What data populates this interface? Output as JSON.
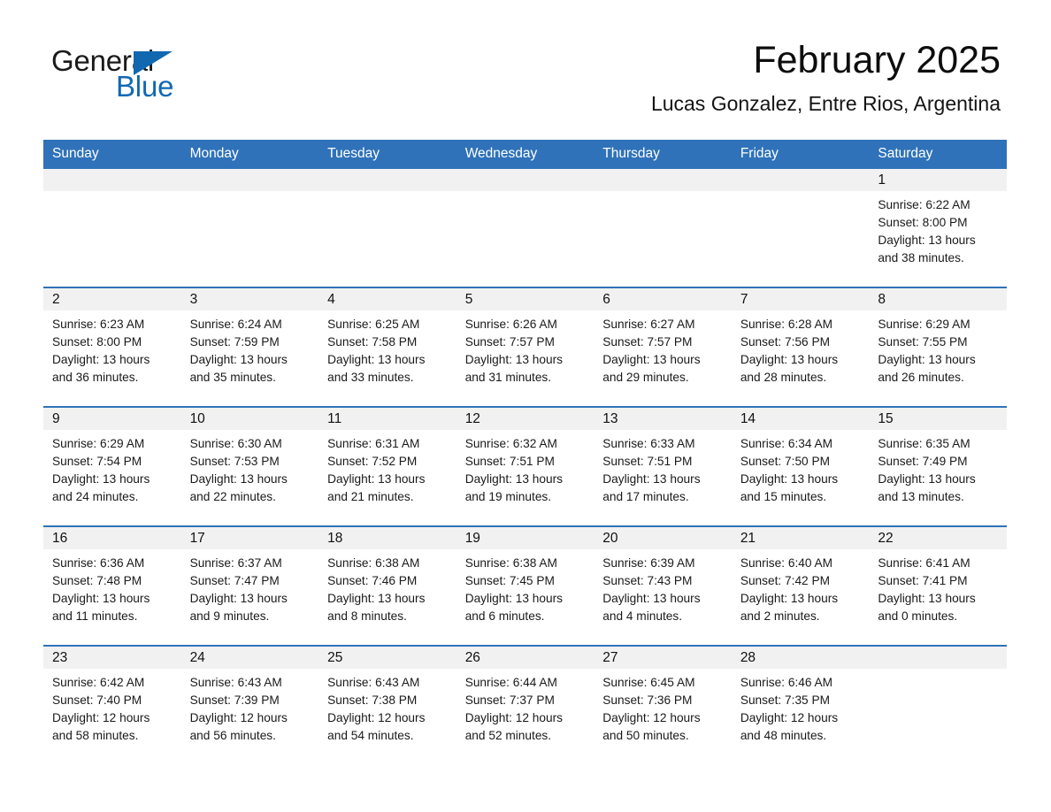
{
  "brand": {
    "name_part1": "General",
    "name_part2": "Blue",
    "logo_icon": "triangle-flag-icon",
    "accent_color": "#1268b3"
  },
  "header": {
    "month_title": "February 2025",
    "location": "Lucas Gonzalez, Entre Rios, Argentina"
  },
  "theme": {
    "header_blue": "#2f72b9",
    "row_divider_blue": "#2f72b9",
    "daynum_band": "#f1f1f1"
  },
  "calendar": {
    "weekday_headers": [
      "Sunday",
      "Monday",
      "Tuesday",
      "Wednesday",
      "Thursday",
      "Friday",
      "Saturday"
    ],
    "weeks": [
      [
        {
          "day": "",
          "sunrise": "",
          "sunset": "",
          "daylight": "",
          "empty": true
        },
        {
          "day": "",
          "sunrise": "",
          "sunset": "",
          "daylight": "",
          "empty": true
        },
        {
          "day": "",
          "sunrise": "",
          "sunset": "",
          "daylight": "",
          "empty": true
        },
        {
          "day": "",
          "sunrise": "",
          "sunset": "",
          "daylight": "",
          "empty": true
        },
        {
          "day": "",
          "sunrise": "",
          "sunset": "",
          "daylight": "",
          "empty": true
        },
        {
          "day": "",
          "sunrise": "",
          "sunset": "",
          "daylight": "",
          "empty": true
        },
        {
          "day": "1",
          "sunrise": "Sunrise: 6:22 AM",
          "sunset": "Sunset: 8:00 PM",
          "daylight": "Daylight: 13 hours and 38 minutes.",
          "empty": false
        }
      ],
      [
        {
          "day": "2",
          "sunrise": "Sunrise: 6:23 AM",
          "sunset": "Sunset: 8:00 PM",
          "daylight": "Daylight: 13 hours and 36 minutes.",
          "empty": false
        },
        {
          "day": "3",
          "sunrise": "Sunrise: 6:24 AM",
          "sunset": "Sunset: 7:59 PM",
          "daylight": "Daylight: 13 hours and 35 minutes.",
          "empty": false
        },
        {
          "day": "4",
          "sunrise": "Sunrise: 6:25 AM",
          "sunset": "Sunset: 7:58 PM",
          "daylight": "Daylight: 13 hours and 33 minutes.",
          "empty": false
        },
        {
          "day": "5",
          "sunrise": "Sunrise: 6:26 AM",
          "sunset": "Sunset: 7:57 PM",
          "daylight": "Daylight: 13 hours and 31 minutes.",
          "empty": false
        },
        {
          "day": "6",
          "sunrise": "Sunrise: 6:27 AM",
          "sunset": "Sunset: 7:57 PM",
          "daylight": "Daylight: 13 hours and 29 minutes.",
          "empty": false
        },
        {
          "day": "7",
          "sunrise": "Sunrise: 6:28 AM",
          "sunset": "Sunset: 7:56 PM",
          "daylight": "Daylight: 13 hours and 28 minutes.",
          "empty": false
        },
        {
          "day": "8",
          "sunrise": "Sunrise: 6:29 AM",
          "sunset": "Sunset: 7:55 PM",
          "daylight": "Daylight: 13 hours and 26 minutes.",
          "empty": false
        }
      ],
      [
        {
          "day": "9",
          "sunrise": "Sunrise: 6:29 AM",
          "sunset": "Sunset: 7:54 PM",
          "daylight": "Daylight: 13 hours and 24 minutes.",
          "empty": false
        },
        {
          "day": "10",
          "sunrise": "Sunrise: 6:30 AM",
          "sunset": "Sunset: 7:53 PM",
          "daylight": "Daylight: 13 hours and 22 minutes.",
          "empty": false
        },
        {
          "day": "11",
          "sunrise": "Sunrise: 6:31 AM",
          "sunset": "Sunset: 7:52 PM",
          "daylight": "Daylight: 13 hours and 21 minutes.",
          "empty": false
        },
        {
          "day": "12",
          "sunrise": "Sunrise: 6:32 AM",
          "sunset": "Sunset: 7:51 PM",
          "daylight": "Daylight: 13 hours and 19 minutes.",
          "empty": false
        },
        {
          "day": "13",
          "sunrise": "Sunrise: 6:33 AM",
          "sunset": "Sunset: 7:51 PM",
          "daylight": "Daylight: 13 hours and 17 minutes.",
          "empty": false
        },
        {
          "day": "14",
          "sunrise": "Sunrise: 6:34 AM",
          "sunset": "Sunset: 7:50 PM",
          "daylight": "Daylight: 13 hours and 15 minutes.",
          "empty": false
        },
        {
          "day": "15",
          "sunrise": "Sunrise: 6:35 AM",
          "sunset": "Sunset: 7:49 PM",
          "daylight": "Daylight: 13 hours and 13 minutes.",
          "empty": false
        }
      ],
      [
        {
          "day": "16",
          "sunrise": "Sunrise: 6:36 AM",
          "sunset": "Sunset: 7:48 PM",
          "daylight": "Daylight: 13 hours and 11 minutes.",
          "empty": false
        },
        {
          "day": "17",
          "sunrise": "Sunrise: 6:37 AM",
          "sunset": "Sunset: 7:47 PM",
          "daylight": "Daylight: 13 hours and 9 minutes.",
          "empty": false
        },
        {
          "day": "18",
          "sunrise": "Sunrise: 6:38 AM",
          "sunset": "Sunset: 7:46 PM",
          "daylight": "Daylight: 13 hours and 8 minutes.",
          "empty": false
        },
        {
          "day": "19",
          "sunrise": "Sunrise: 6:38 AM",
          "sunset": "Sunset: 7:45 PM",
          "daylight": "Daylight: 13 hours and 6 minutes.",
          "empty": false
        },
        {
          "day": "20",
          "sunrise": "Sunrise: 6:39 AM",
          "sunset": "Sunset: 7:43 PM",
          "daylight": "Daylight: 13 hours and 4 minutes.",
          "empty": false
        },
        {
          "day": "21",
          "sunrise": "Sunrise: 6:40 AM",
          "sunset": "Sunset: 7:42 PM",
          "daylight": "Daylight: 13 hours and 2 minutes.",
          "empty": false
        },
        {
          "day": "22",
          "sunrise": "Sunrise: 6:41 AM",
          "sunset": "Sunset: 7:41 PM",
          "daylight": "Daylight: 13 hours and 0 minutes.",
          "empty": false
        }
      ],
      [
        {
          "day": "23",
          "sunrise": "Sunrise: 6:42 AM",
          "sunset": "Sunset: 7:40 PM",
          "daylight": "Daylight: 12 hours and 58 minutes.",
          "empty": false
        },
        {
          "day": "24",
          "sunrise": "Sunrise: 6:43 AM",
          "sunset": "Sunset: 7:39 PM",
          "daylight": "Daylight: 12 hours and 56 minutes.",
          "empty": false
        },
        {
          "day": "25",
          "sunrise": "Sunrise: 6:43 AM",
          "sunset": "Sunset: 7:38 PM",
          "daylight": "Daylight: 12 hours and 54 minutes.",
          "empty": false
        },
        {
          "day": "26",
          "sunrise": "Sunrise: 6:44 AM",
          "sunset": "Sunset: 7:37 PM",
          "daylight": "Daylight: 12 hours and 52 minutes.",
          "empty": false
        },
        {
          "day": "27",
          "sunrise": "Sunrise: 6:45 AM",
          "sunset": "Sunset: 7:36 PM",
          "daylight": "Daylight: 12 hours and 50 minutes.",
          "empty": false
        },
        {
          "day": "28",
          "sunrise": "Sunrise: 6:46 AM",
          "sunset": "Sunset: 7:35 PM",
          "daylight": "Daylight: 12 hours and 48 minutes.",
          "empty": false
        },
        {
          "day": "",
          "sunrise": "",
          "sunset": "",
          "daylight": "",
          "empty": true
        }
      ]
    ]
  }
}
